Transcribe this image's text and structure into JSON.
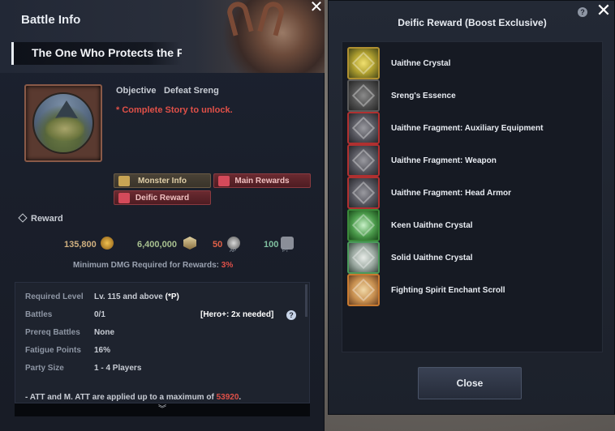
{
  "left_panel": {
    "title": "Battle Info",
    "close_glyph": "✕",
    "battle_name": "The One Who Protects the F",
    "objective_label": "Objective",
    "objective_value": "Defeat Sreng",
    "unlock_note": "* Complete Story to unlock.",
    "tabs": {
      "monster_info": "Monster Info",
      "main_rewards": "Main Rewards",
      "deific_reward": "Deific Reward"
    },
    "reward_header": "Reward",
    "rewards": {
      "gold": "135,800",
      "silver": "6,400,000",
      "ap": "50",
      "ap_sub": "AP",
      "pt": "100",
      "pt_sub": "PT"
    },
    "min_dmg_label": "Minimum DMG Required for Rewards:",
    "min_dmg_value": "3%",
    "info": {
      "required_level_label": "Required Level",
      "required_level_value": "Lv. 115 and above",
      "required_level_extra": "(*P)",
      "battles_label": "Battles",
      "battles_value": "0/1",
      "hero_note": "[Hero+: 2x needed]",
      "prereq_label": "Prereq Battles",
      "prereq_value": "None",
      "fatigue_label": "Fatigue Points",
      "fatigue_value": "16%",
      "party_label": "Party Size",
      "party_value": "1 - 4 Players",
      "footer_text": "- ATT and M. ATT are applied up to a maximum of",
      "footer_max": "53920",
      "footer_end": "."
    },
    "expand_glyph": "︾"
  },
  "right_panel": {
    "title": "Deific Reward (Boost Exclusive)",
    "help_glyph": "?",
    "close_glyph": "✕",
    "items": [
      {
        "name": "Uaithne Crystal",
        "icon": "yellow-crystal-icon"
      },
      {
        "name": "Sreng's Essence",
        "icon": "essence-icon"
      },
      {
        "name": "Uaithne Fragment: Auxiliary Equipment",
        "icon": "fragment-icon"
      },
      {
        "name": "Uaithne Fragment: Weapon",
        "icon": "fragment-icon"
      },
      {
        "name": "Uaithne Fragment: Head Armor",
        "icon": "fragment-icon"
      },
      {
        "name": "Keen Uaithne Crystal",
        "icon": "green-crystal-icon"
      },
      {
        "name": "Solid Uaithne Crystal",
        "icon": "white-crystal-icon"
      },
      {
        "name": "Fighting Spirit Enchant Scroll",
        "icon": "scroll-icon"
      }
    ],
    "close_button": "Close"
  },
  "colors": {
    "accent_red": "#e05048",
    "panel_bg": "#1c212b"
  }
}
